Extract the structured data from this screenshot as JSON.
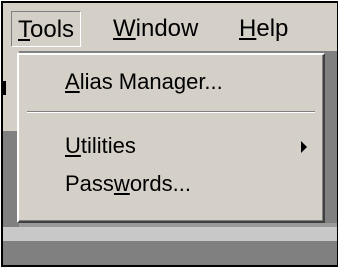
{
  "menubar": {
    "items": [
      {
        "accel": "T",
        "rest": "ools"
      },
      {
        "accel": "W",
        "rest": "indow"
      },
      {
        "accel": "H",
        "rest": "elp"
      }
    ]
  },
  "tools_menu": {
    "alias_manager": {
      "accel": "A",
      "rest": "lias Manager..."
    },
    "utilities": {
      "accel": "U",
      "rest": "tilities"
    },
    "passwords": {
      "pre": "Pass",
      "accel": "w",
      "rest": "ords..."
    }
  },
  "colors": {
    "menu_face": "#d4d0c8",
    "app_background": "#808080",
    "shadow": "#808080",
    "highlight": "#ffffff"
  },
  "icons": {
    "submenu_arrow": "submenu-arrow-icon"
  }
}
